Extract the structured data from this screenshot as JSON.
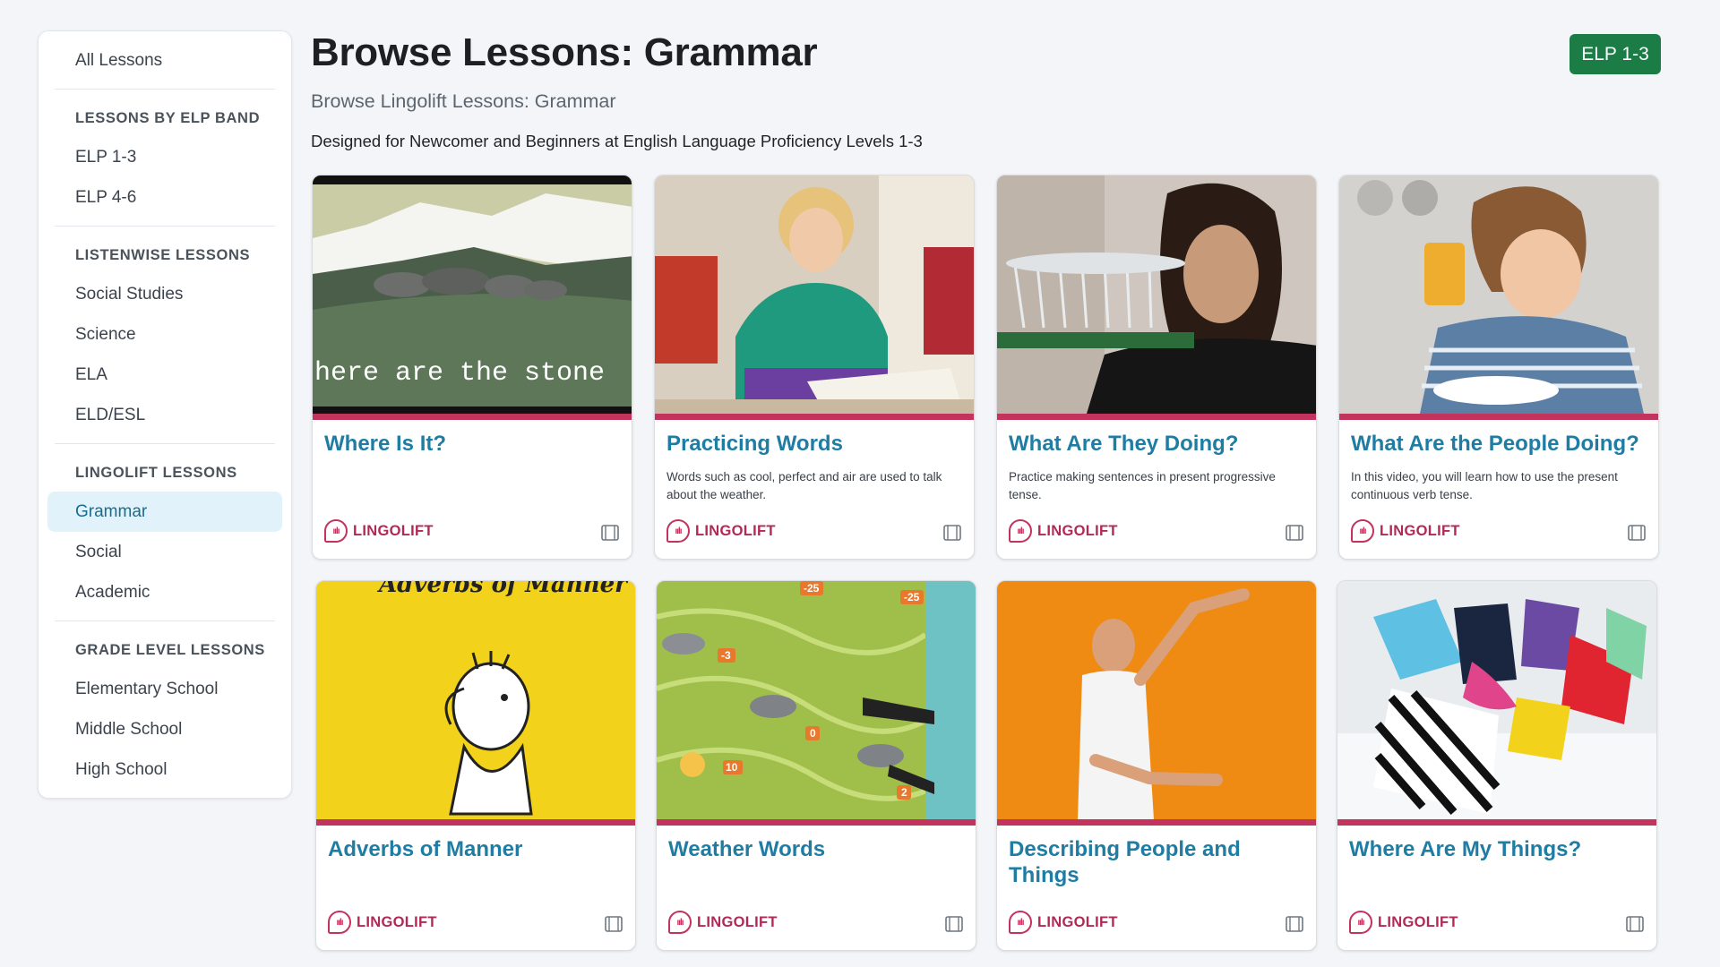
{
  "sidebar": {
    "all_lessons": "All Lessons",
    "sections": [
      {
        "heading": "LESSONS BY ELP BAND",
        "items": [
          "ELP 1-3",
          "ELP 4-6"
        ]
      },
      {
        "heading": "LISTENWISE LESSONS",
        "items": [
          "Social Studies",
          "Science",
          "ELA",
          "ELD/ESL"
        ]
      },
      {
        "heading": "LINGOLIFT LESSONS",
        "items": [
          "Grammar",
          "Social",
          "Academic"
        ]
      },
      {
        "heading": "GRADE LEVEL LESSONS",
        "items": [
          "Elementary School",
          "Middle School",
          "High School"
        ]
      }
    ],
    "active_item": "Grammar"
  },
  "header": {
    "title": "Browse Lessons: Grammar",
    "subtitle": "Browse Lingolift Lessons: Grammar",
    "description": "Designed for Newcomer and Beginners at English Language Proficiency Levels 1-3",
    "badge": "ELP 1-3"
  },
  "cards": [
    {
      "title": "Where Is It?",
      "description": "",
      "brand": "LINGOLIFT",
      "thumb_caption": "here are the stone",
      "thumb": "stones-landscape"
    },
    {
      "title": "Practicing Words",
      "description": "Words such as cool, perfect and air are used to talk about the weather.",
      "brand": "LINGOLIFT",
      "thumb": "student-writing"
    },
    {
      "title": "What Are They Doing?",
      "description": "Practice making sentences in present progressive tense.",
      "brand": "LINGOLIFT",
      "thumb": "waiter-glasses"
    },
    {
      "title": "What Are the People Doing?",
      "description": "In this video, you will learn how to use the present continuous verb tense.",
      "brand": "LINGOLIFT",
      "thumb": "boy-drinking-juice"
    },
    {
      "title": "Adverbs of Manner",
      "description": "",
      "brand": "LINGOLIFT",
      "thumb_caption": "Adverbs of Manner",
      "thumb": "cartoon-thinking-man"
    },
    {
      "title": "Weather Words",
      "description": "",
      "brand": "LINGOLIFT",
      "thumb": "weather-map",
      "thumb_labels": [
        "-25",
        "-25",
        "-3",
        "0",
        "10",
        "2"
      ]
    },
    {
      "title": "Describing People and Things",
      "description": "",
      "brand": "LINGOLIFT",
      "thumb": "man-orange-background"
    },
    {
      "title": "Where Are My Things?",
      "description": "",
      "brand": "LINGOLIFT",
      "thumb": "clothes-pile"
    }
  ],
  "colors": {
    "accent": "#c2335e",
    "title_link": "#1f7da4",
    "badge": "#1b7d45",
    "active_bg": "#e1f2fb"
  },
  "icons": {
    "brand": "lingolift-logo-icon",
    "media": "film-icon"
  }
}
